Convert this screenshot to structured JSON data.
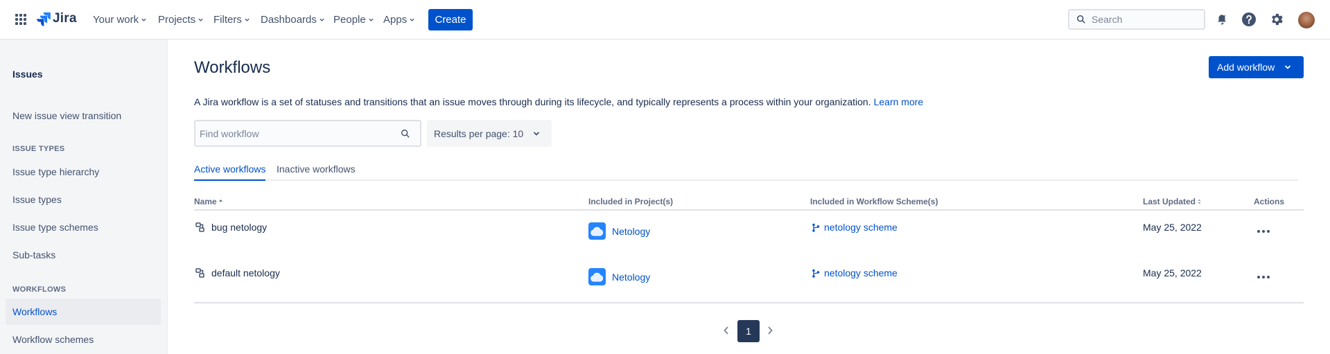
{
  "topnav": {
    "logo_text": "Jira",
    "menu": [
      "Your work",
      "Projects",
      "Filters",
      "Dashboards",
      "People",
      "Apps"
    ],
    "create_label": "Create",
    "search_placeholder": "Search"
  },
  "sidebar": {
    "title": "Issues",
    "items_top": [
      "New issue view transition"
    ],
    "issue_types_heading": "ISSUE TYPES",
    "issue_types_items": [
      "Issue type hierarchy",
      "Issue types",
      "Issue type schemes",
      "Sub-tasks"
    ],
    "workflows_heading": "WORKFLOWS",
    "workflows_items": [
      "Workflows",
      "Workflow schemes"
    ],
    "active_item": "Workflows"
  },
  "main": {
    "title": "Workflows",
    "add_button": "Add workflow",
    "description": "A Jira workflow is a set of statuses and transitions that an issue moves through during its lifecycle, and typically represents a process within your organization.",
    "learn_more": "Learn more",
    "find_placeholder": "Find workflow",
    "results_per_page": "Results per page: 10",
    "tabs": [
      "Active workflows",
      "Inactive workflows"
    ],
    "active_tab": "Active workflows",
    "columns": {
      "name": "Name",
      "projects": "Included in Project(s)",
      "schemes": "Included in Workflow Scheme(s)",
      "updated": "Last Updated",
      "actions": "Actions"
    },
    "rows": [
      {
        "name": "bug netology",
        "project": "Netology",
        "scheme": "netology scheme",
        "updated": "May 25, 2022"
      },
      {
        "name": "default netology",
        "project": "Netology",
        "scheme": "netology scheme",
        "updated": "May 25, 2022"
      }
    ],
    "pagination": {
      "current": "1"
    }
  },
  "colors": {
    "brand_blue": "#0052cc",
    "text": "#172b4d",
    "sidebar_bg": "#f4f5f7"
  }
}
